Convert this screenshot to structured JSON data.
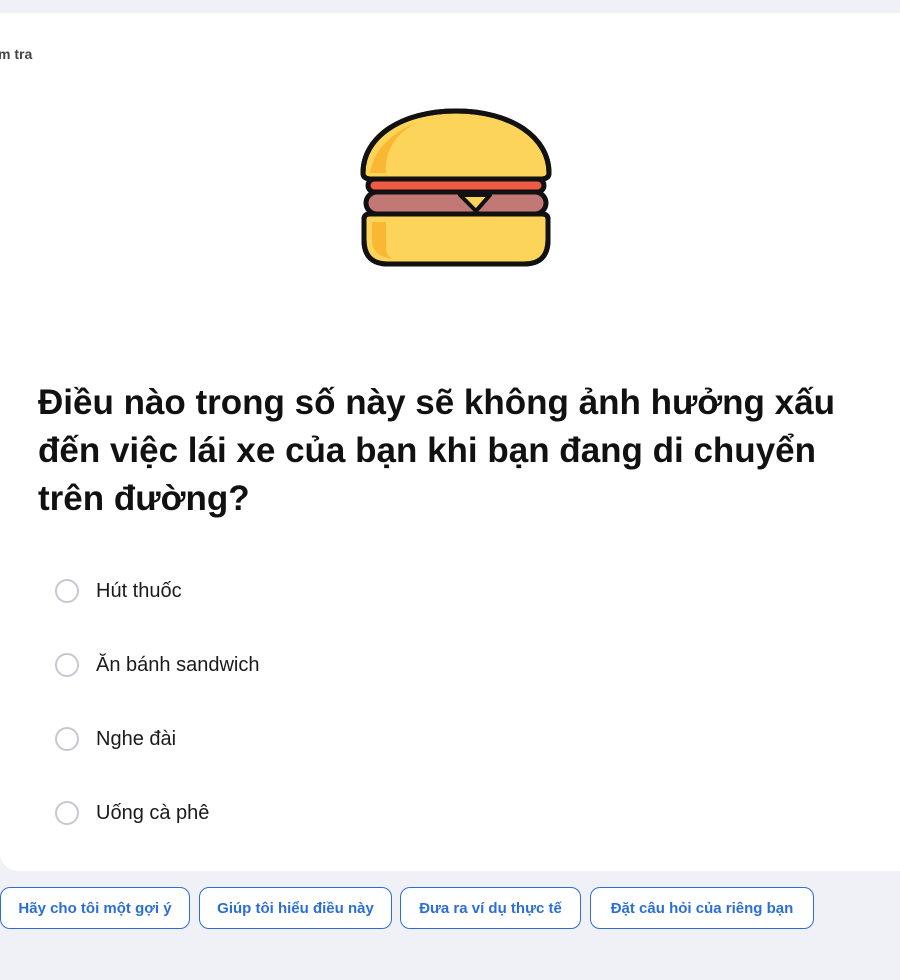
{
  "breadcrumb": "m tra",
  "illustration": {
    "icon": "hamburger-icon",
    "colors": {
      "bun": "#fcd45a",
      "bun_shade": "#f9b733",
      "tomato": "#ef5a45",
      "patty": "#c27975",
      "cheese": "#fcd45a",
      "outline": "#111111"
    }
  },
  "question": {
    "text": "Điều nào trong số này sẽ không ảnh hưởng xấu đến việc lái xe của bạn khi bạn đang di chuyển trên đường?"
  },
  "options": [
    {
      "label": "Hút thuốc"
    },
    {
      "label": "Ăn bánh sandwich"
    },
    {
      "label": "Nghe đài"
    },
    {
      "label": "Uống cà phê"
    }
  ],
  "suggestions": [
    {
      "label": "Hãy cho tôi một gợi ý"
    },
    {
      "label": "Giúp tôi hiểu điều này"
    },
    {
      "label": "Đưa ra ví dụ thực tế"
    },
    {
      "label": "Đặt câu hỏi của riêng bạn"
    }
  ],
  "colors": {
    "accent": "#2b6fd6",
    "page_background": "#f0f1f6",
    "card_background": "#ffffff",
    "radio_border": "#c5c8d3"
  }
}
